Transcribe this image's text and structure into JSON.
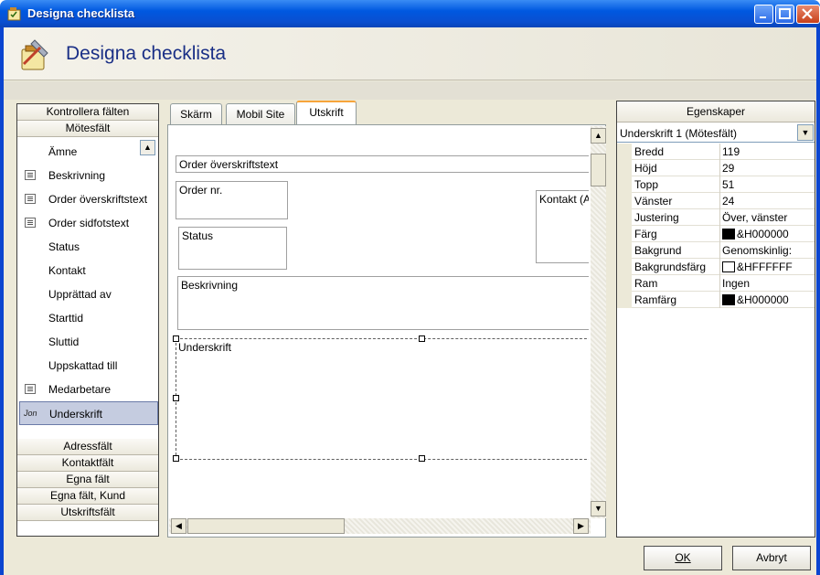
{
  "window": {
    "title": "Designa checklista"
  },
  "header": {
    "title": "Designa checklista"
  },
  "left_panel": {
    "sections_top": [
      "Kontrollera fälten",
      "Mötesfält"
    ],
    "items": [
      {
        "label": "Ämne",
        "icon": ""
      },
      {
        "label": "Beskrivning",
        "icon": "text-field-icon"
      },
      {
        "label": "Order överskriftstext",
        "icon": "text-field-icon"
      },
      {
        "label": "Order sidfotstext",
        "icon": "text-field-icon"
      },
      {
        "label": "Status",
        "icon": ""
      },
      {
        "label": "Kontakt",
        "icon": ""
      },
      {
        "label": "Upprättad av",
        "icon": ""
      },
      {
        "label": "Starttid",
        "icon": ""
      },
      {
        "label": "Sluttid",
        "icon": ""
      },
      {
        "label": "Uppskattad till",
        "icon": ""
      },
      {
        "label": "Medarbetare",
        "icon": "text-field-icon"
      },
      {
        "label": "Underskrift",
        "icon": "signature-icon",
        "selected": true
      }
    ],
    "sections_bottom": [
      "Adressfält",
      "Kontaktfält",
      "Egna fält",
      "Egna fält, Kund",
      "Utskriftsfält"
    ]
  },
  "tabs": [
    "Skärm",
    "Mobil Site",
    "Utskrift"
  ],
  "active_tab": "Utskrift",
  "design": {
    "fields": {
      "order_header": "Order överskriftstext",
      "order_nr": "Order nr.",
      "kontakt": "Kontakt (A",
      "status": "Status",
      "beskrivning": "Beskrivning",
      "underskrift": "Underskrift"
    }
  },
  "properties": {
    "title": "Egenskaper",
    "selected_object": "Underskrift 1 (Mötesfält)",
    "rows": [
      {
        "key": "Bredd",
        "value": "119"
      },
      {
        "key": "Höjd",
        "value": "29"
      },
      {
        "key": "Topp",
        "value": "51"
      },
      {
        "key": "Vänster",
        "value": "24"
      },
      {
        "key": "Justering",
        "value": "Över, vänster"
      },
      {
        "key": "Färg",
        "value": "&H000000",
        "swatch": "#000000"
      },
      {
        "key": "Bakgrund",
        "value": "Genomskinlig:"
      },
      {
        "key": "Bakgrundsfärg",
        "value": "&HFFFFFF",
        "swatch": "#FFFFFF"
      },
      {
        "key": "Ram",
        "value": "Ingen"
      },
      {
        "key": "Ramfärg",
        "value": "&H000000",
        "swatch": "#000000"
      }
    ]
  },
  "buttons": {
    "ok": "OK",
    "cancel": "Avbryt"
  }
}
